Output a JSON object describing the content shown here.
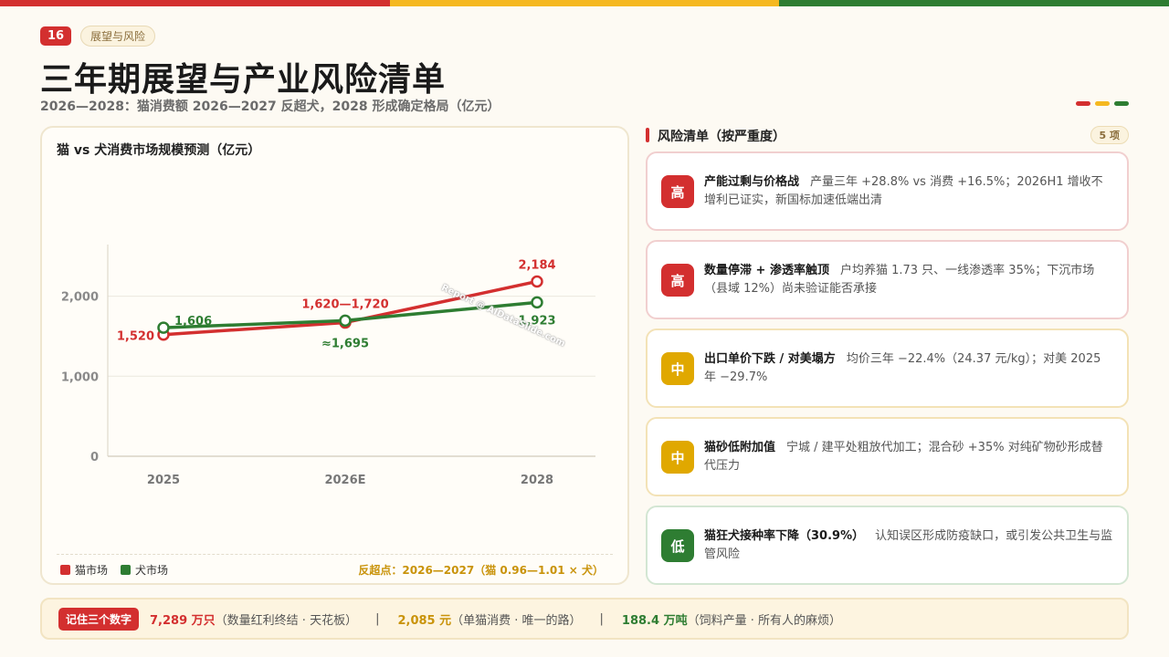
{
  "top_bar_colors": [
    "#d32f2f",
    "#f5b820",
    "#2e7d32"
  ],
  "header": {
    "page_number": "16",
    "section_tag": "展望与风险",
    "title": "三年期展望与产业风险清单",
    "subtitle": "2026—2028：猫消费额 2026—2027 反超犬，2028 形成确定格局（亿元）"
  },
  "chart_panel": {
    "title": "猫 vs 犬消费市场规模预测（亿元）",
    "watermark": "Report @ AIDataSlide.com",
    "crossover_note": "反超点：2026—2027（猫 0.96—1.01 × 犬）"
  },
  "chart_data": {
    "type": "line",
    "categories": [
      "2025",
      "2026E",
      "2028"
    ],
    "ylim": [
      0,
      2600
    ],
    "yticks": [
      0,
      1000,
      2000
    ],
    "ytick_labels": [
      "0",
      "1,000",
      "2,000"
    ],
    "grid": true,
    "legend": "bottom-left",
    "series": [
      {
        "name": "猫市场",
        "color": "#d32f2f",
        "values": [
          1520,
          1670,
          2184
        ],
        "labels": [
          "1,520",
          "1,620—1,720",
          "2,184"
        ]
      },
      {
        "name": "犬市场",
        "color": "#2e7d32",
        "values": [
          1606,
          1695,
          1923
        ],
        "labels": [
          "1,606",
          "≈1,695",
          "1,923"
        ]
      }
    ]
  },
  "risk_panel": {
    "title": "风险清单（按严重度）",
    "count": "5 项",
    "items": [
      {
        "level": "高",
        "color": "#d32f2f",
        "border": "#f1cfcf",
        "name": "产能过剩与价格战",
        "desc": "产量三年 +28.8% vs 消费 +16.5%；2026H1 增收不增利已证实，新国标加速低端出清"
      },
      {
        "level": "高",
        "color": "#d32f2f",
        "border": "#f1cfcf",
        "name": "数量停滞 + 渗透率触顶",
        "desc": "户均养猫 1.73 只、一线渗透率 35%；下沉市场（县域 12%）尚未验证能否承接"
      },
      {
        "level": "中",
        "color": "#e0a800",
        "border": "#f3e2b6",
        "name": "出口单价下跌 / 对美塌方",
        "desc": "均价三年 −22.4%（24.37 元/kg）；对美 2025 年 −29.7%"
      },
      {
        "level": "中",
        "color": "#e0a800",
        "border": "#f3e2b6",
        "name": "猫砂低附加值",
        "desc": "宁城 / 建平处粗放代加工；混合砂 +35% 对纯矿物砂形成替代压力"
      },
      {
        "level": "低",
        "color": "#2e7d32",
        "border": "#d3e6d3",
        "name": "猫狂犬接种率下降（30.9%）",
        "desc": "认知误区形成防疫缺口，或引发公共卫生与监管风险"
      }
    ]
  },
  "footer": {
    "tag": "记住三个数字",
    "items": [
      {
        "value": "7,289 万只",
        "note": "（数量红利终结 · 天花板）",
        "color": "#d32f2f"
      },
      {
        "value": "2,085 元",
        "note": "（单猫消费 · 唯一的路）",
        "color": "#c9930a"
      },
      {
        "value": "188.4 万吨",
        "note": "（饲料产量 · 所有人的麻烦）",
        "color": "#2e7d32"
      }
    ],
    "separator": "|"
  }
}
